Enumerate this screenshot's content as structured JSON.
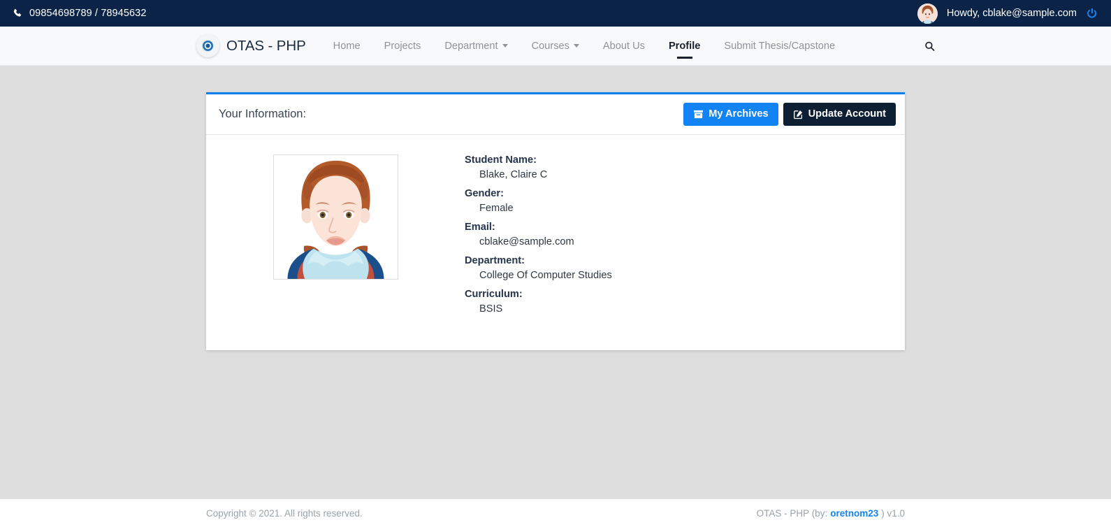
{
  "topbar": {
    "phone_icon": "phone-icon",
    "phone": "09854698789 / 78945632",
    "avatar_icon": "user-avatar",
    "greeting": "Howdy, cblake@sample.com",
    "logout_icon": "power-icon"
  },
  "navbar": {
    "logo_icon": "otas-logo-icon",
    "brand": "OTAS - PHP",
    "links": [
      {
        "label": "Home",
        "active": false,
        "caret": false
      },
      {
        "label": "Projects",
        "active": false,
        "caret": false
      },
      {
        "label": "Department",
        "active": false,
        "caret": true
      },
      {
        "label": "Courses",
        "active": false,
        "caret": true
      },
      {
        "label": "About Us",
        "active": false,
        "caret": false
      },
      {
        "label": "Profile",
        "active": true,
        "caret": false
      },
      {
        "label": "Submit Thesis/Capstone",
        "active": false,
        "caret": false
      }
    ],
    "search_icon": "search-icon"
  },
  "card": {
    "title": "Your Information:",
    "archives_icon": "archive-icon",
    "archives_label": "My Archives",
    "update_icon": "edit-square-icon",
    "update_label": "Update Account",
    "photo_icon": "student-photo",
    "fields": [
      {
        "label": "Student Name:",
        "value": "Blake, Claire C"
      },
      {
        "label": "Gender:",
        "value": "Female"
      },
      {
        "label": "Email:",
        "value": "cblake@sample.com"
      },
      {
        "label": "Department:",
        "value": "College Of Computer Studies"
      },
      {
        "label": "Curriculum:",
        "value": "BSIS"
      }
    ]
  },
  "footer": {
    "copyright": "Copyright © 2021. All rights reserved.",
    "app": "OTAS - PHP (by:",
    "author": "oretnom23",
    "version": ") v1.0"
  },
  "colors": {
    "topbar_bg": "#0a2347",
    "navbar_bg": "#f8f9fa",
    "page_bg": "#dededf",
    "accent": "#1283f2",
    "card_border_top": "#0d7ef0",
    "dark_button": "#0f1f33"
  }
}
